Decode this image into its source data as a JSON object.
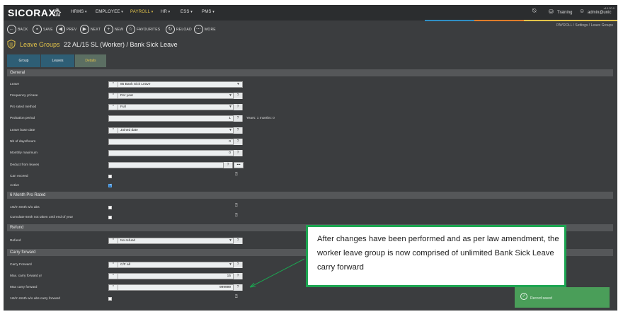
{
  "app": {
    "name": "SICORAX",
    "reg": "®",
    "version": "v10.20.0"
  },
  "nav": [
    {
      "label": "HRMS",
      "active": false
    },
    {
      "label": "EMPLOYEE",
      "active": false
    },
    {
      "label": "PAYROLL",
      "active": true
    },
    {
      "label": "HR",
      "active": false
    },
    {
      "label": "ESS",
      "active": false
    },
    {
      "label": "PMS",
      "active": false
    }
  ],
  "topright": {
    "env": "Training",
    "user": "admin@unic"
  },
  "toolbar": {
    "back": "BACK",
    "save": "SAVE",
    "prev": "PREV",
    "next": "NEXT",
    "new": "NEW",
    "favourites": "FAVOURITES",
    "reload": "RELOAD",
    "more": "MORE"
  },
  "breadcrumb": "PAYROLL  /  Settings  /  Leave Groups",
  "title": {
    "module": "Leave Groups",
    "record": "22 AL/15 SL (Worker) /  Bank Sick Leave"
  },
  "tabs": [
    "Group",
    "Leaves",
    "Details"
  ],
  "sections": {
    "general": "General",
    "pro": "6 Month Pro Rated",
    "refund": "Refund",
    "carry": "Carry forward"
  },
  "fields": {
    "leave": {
      "label": "Leave",
      "value": "85 Bank Sick Leave"
    },
    "frequency": {
      "label": "Frequency yr/case",
      "value": "Per year"
    },
    "prorated": {
      "label": "Pro rated method",
      "value": "Full"
    },
    "probation": {
      "label": "Probation period",
      "value": "1",
      "extra": "Years: 1 months: 0"
    },
    "basedate": {
      "label": "Leave base date",
      "value": "Joined date"
    },
    "nbdays": {
      "label": "Nb of days/hours",
      "value": "0"
    },
    "monthly": {
      "label": "Monthly maximum",
      "value": "0"
    },
    "deduct": {
      "label": "Deduct from leaves",
      "value": ""
    },
    "canexceed": {
      "label": "Can exceed",
      "checked": false
    },
    "active": {
      "label": "Active",
      "checked": true
    },
    "firstm": {
      "label": "1st/m 6mth w/o abs",
      "checked": false
    },
    "cumulate": {
      "label": "Cumulate 6mth not taken until end of year",
      "checked": false
    },
    "refund": {
      "label": "Refund",
      "value": "No refund"
    },
    "carryfwd": {
      "label": "Carry Forward",
      "value": "C/F all"
    },
    "maxcfyr": {
      "label": "Max. carry forward yr",
      "value": "15"
    },
    "maxcf": {
      "label": "Max carry forward",
      "value": "999999"
    },
    "firstmcf": {
      "label": "1st/m 6mth w/o abs carry forward",
      "checked": false
    }
  },
  "callout": "After changes have been performed and as per law amendment, the worker leave group is now comprised of unlimited Bank Sick Leave carry forward",
  "toast": "Record saved"
}
